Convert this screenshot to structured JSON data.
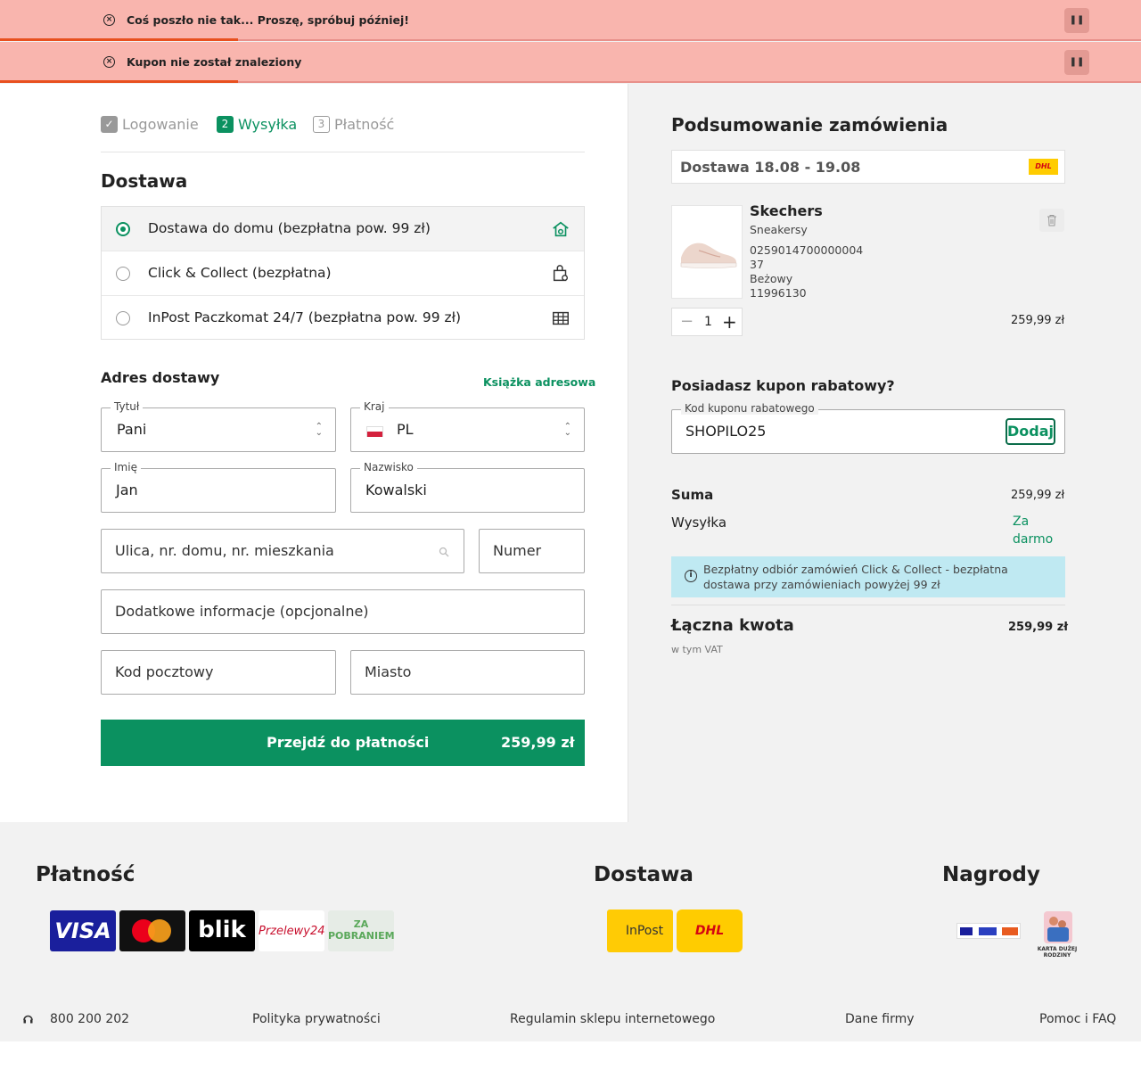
{
  "alerts": [
    {
      "message": "Coś poszło nie tak... Proszę, spróbuj później!"
    },
    {
      "message": "Kupon nie został znaleziony"
    }
  ],
  "steps": [
    {
      "num": "✓",
      "label": "Logowanie"
    },
    {
      "num": "2",
      "label": "Wysyłka"
    },
    {
      "num": "3",
      "label": "Płatność"
    }
  ],
  "delivery": {
    "title": "Dostawa",
    "options": [
      {
        "label": "Dostawa do domu (bezpłatna pow. 99 zł)",
        "icon": "home-icon"
      },
      {
        "label": "Click & Collect (bezpłatna)",
        "icon": "store-bag-icon"
      },
      {
        "label": "InPost Paczkomat 24/7 (bezpłatna pow. 99 zł)",
        "icon": "parcel-locker-icon"
      }
    ]
  },
  "address": {
    "title": "Adres dostawy",
    "address_book": "Książka adresowa",
    "title_field": {
      "label": "Tytuł",
      "value": "Pani"
    },
    "country_field": {
      "label": "Kraj",
      "value": "PL"
    },
    "first_name": {
      "label": "Imię",
      "value": "Jan"
    },
    "last_name": {
      "label": "Nazwisko",
      "value": "Kowalski"
    },
    "street_placeholder": "Ulica, nr. domu, nr. mieszkania",
    "number_placeholder": "Numer",
    "extra_placeholder": "Dodatkowe informacje (opcjonalne)",
    "zip_placeholder": "Kod pocztowy",
    "city_placeholder": "Miasto"
  },
  "cta": {
    "label": "Przejdź do płatności",
    "amount": "259,99 zł"
  },
  "summary": {
    "title": "Podsumowanie zamówienia",
    "delivery_window": "Dostawa 18.08 - 19.08",
    "carrier_badge": "DHL",
    "product": {
      "brand": "Skechers",
      "category": "Sneakersy",
      "sku": "0259014700000004",
      "size": "37",
      "color": "Beżowy",
      "code": "11996130",
      "qty": "1",
      "price": "259,99 zł"
    },
    "coupon": {
      "question": "Posiadasz kupon rabatowy?",
      "label": "Kod kuponu rabatowego",
      "value": "SHOPILO25",
      "button": "Dodaj"
    },
    "sum_label": "Suma",
    "sum_value": "259,99 zł",
    "shipping_label": "Wysyłka",
    "shipping_value_1": "Za",
    "shipping_value_2": "darmo",
    "info": "Bezpłatny odbiór zamówień Click & Collect - bezpłatna dostawa przy zamówieniach powyżej 99 zł",
    "total_label": "Łączna kwota",
    "total_value": "259,99 zł",
    "vat_note": "w tym VAT"
  },
  "footer": {
    "payment_title": "Płatność",
    "delivery_title": "Dostawa",
    "rewards_title": "Nagrody",
    "payment_logos": {
      "visa": "VISA",
      "blik": "blik",
      "p24": "Przelewy24",
      "cod_1": "ZA",
      "cod_2": "POBRANIEM"
    },
    "delivery_logos": {
      "inpost": "InPost",
      "dhl": "DHL"
    },
    "rewards_logos": {
      "family_card": "KARTA DUŻEJ RODZINY"
    },
    "phone": "800 200 202",
    "links": [
      "Polityka prywatności",
      "Regulamin sklepu internetowego",
      "Dane firmy",
      "Pomoc i FAQ"
    ]
  },
  "colors": {
    "accent": "#0b9160",
    "alert_bg": "#f9b5ae",
    "alert_bar": "#e8501f",
    "info_bg": "#bfe9f2"
  }
}
